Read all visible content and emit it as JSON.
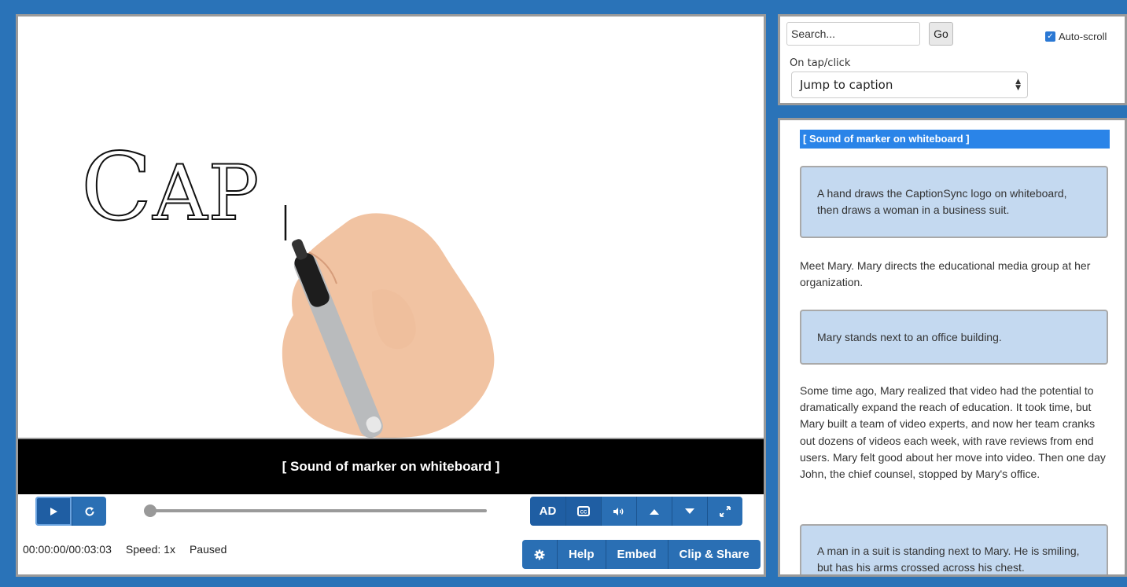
{
  "video": {
    "title_first": "C",
    "title_rest": "AP",
    "caption": "[ Sound of marker on whiteboard ]"
  },
  "controls": {
    "play_icon": "play-icon",
    "restart_icon": "restart-icon",
    "seek_progress": 0,
    "ad_label": "AD",
    "cc_icon": "closed-captions-icon",
    "volume_icon": "volume-icon",
    "faster_icon": "caret-up-icon",
    "slower_icon": "caret-down-icon",
    "fullscreen_icon": "fullscreen-icon",
    "time": "00:00:00/00:03:03",
    "speed": "Speed: 1x",
    "state": "Paused",
    "settings_icon": "gear-icon",
    "help_label": "Help",
    "embed_label": "Embed",
    "clip_label": "Clip & Share"
  },
  "search": {
    "placeholder": "Search...",
    "go_label": "Go",
    "autoscroll_label": "Auto-scroll",
    "autoscroll_checked": true,
    "ontap_label": "On tap/click",
    "ontap_value": "Jump to caption"
  },
  "transcript": {
    "current": "[ Sound of marker on whiteboard ]",
    "ad1": "A hand draws the CaptionSync logo on whiteboard, then draws a woman in a business suit.",
    "p1": "Meet Mary. Mary directs the educational media group at her organization.",
    "ad2": "Mary stands next to an office building.",
    "p2": "Some time ago, Mary realized that video had the potential to dramatically expand the reach of education. It took time, but Mary built a team of video experts, and now her team cranks out dozens of videos each week, with rave reviews from end users. Mary felt good about her move into video. Then one day John, the chief counsel, stopped by Mary's office.",
    "ad3": "A man in a suit is standing next to Mary. He is smiling, but has his arms crossed across his chest."
  },
  "colors": {
    "background": "#2a73b8",
    "button": "#2a6fb4",
    "highlight": "#2a84e8",
    "ad_box": "#c4d9f0"
  }
}
